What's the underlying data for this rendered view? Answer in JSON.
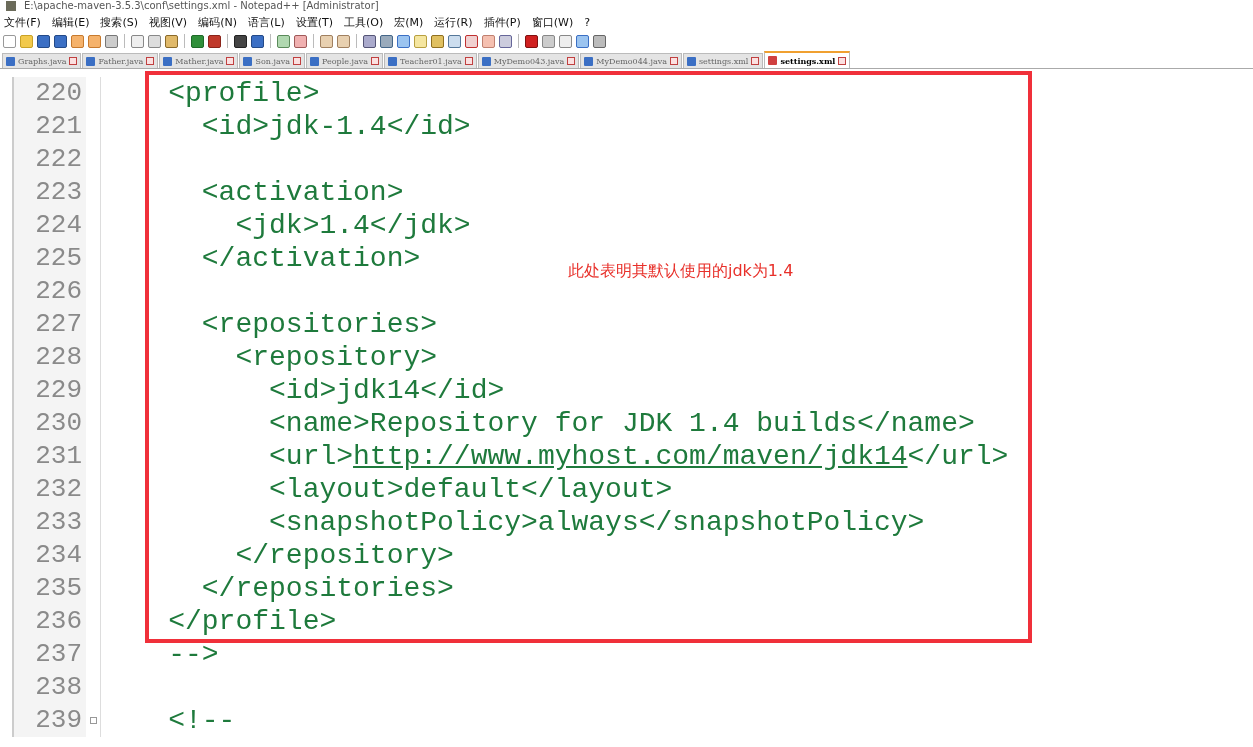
{
  "window": {
    "title": "E:\\apache-maven-3.5.3\\conf\\settings.xml - Notepad++ [Administrator]"
  },
  "menu": [
    "文件(F)",
    "编辑(E)",
    "搜索(S)",
    "视图(V)",
    "编码(N)",
    "语言(L)",
    "设置(T)",
    "工具(O)",
    "宏(M)",
    "运行(R)",
    "插件(P)",
    "窗口(W)",
    "?"
  ],
  "tabs": [
    {
      "label": "Graphs.java",
      "selected": false
    },
    {
      "label": "Father.java",
      "selected": false
    },
    {
      "label": "Mather.java",
      "selected": false
    },
    {
      "label": "Son.java",
      "selected": false
    },
    {
      "label": "People.java",
      "selected": false
    },
    {
      "label": "Teacher01.java",
      "selected": false
    },
    {
      "label": "MyDemo043.java",
      "selected": false
    },
    {
      "label": "MyDemo044.java",
      "selected": false
    },
    {
      "label": "settings.xml",
      "selected": false
    },
    {
      "label": "settings.xml",
      "selected": true
    }
  ],
  "editor": {
    "lines": [
      {
        "number": "220",
        "parts": [
          {
            "kind": "code",
            "text": "    <profile>"
          }
        ]
      },
      {
        "number": "221",
        "parts": [
          {
            "kind": "code",
            "text": "      <id>jdk-1.4</id>"
          }
        ]
      },
      {
        "number": "222"
      },
      {
        "number": "223",
        "parts": [
          {
            "kind": "code",
            "text": "      <activation>"
          }
        ]
      },
      {
        "number": "224",
        "parts": [
          {
            "kind": "code",
            "text": "        <jdk>1.4</jdk>"
          }
        ]
      },
      {
        "number": "225",
        "parts": [
          {
            "kind": "code",
            "text": "      </activation>"
          }
        ]
      },
      {
        "number": "226"
      },
      {
        "number": "227",
        "parts": [
          {
            "kind": "code",
            "text": "      <repositories>"
          }
        ]
      },
      {
        "number": "228",
        "parts": [
          {
            "kind": "code",
            "text": "        <repository>"
          }
        ]
      },
      {
        "number": "229",
        "parts": [
          {
            "kind": "code",
            "text": "          <id>jdk14</id>"
          }
        ]
      },
      {
        "number": "230",
        "parts": [
          {
            "kind": "code",
            "text": "          <name>Repository for JDK 1.4 builds</name>"
          }
        ]
      },
      {
        "number": "231",
        "parts": [
          {
            "kind": "code",
            "text": "          <url>"
          },
          {
            "kind": "link",
            "text": "http://www.myhost.com/maven/jdk14"
          },
          {
            "kind": "code",
            "text": "</url>"
          }
        ]
      },
      {
        "number": "232",
        "parts": [
          {
            "kind": "code",
            "text": "          <layout>default</layout>"
          }
        ]
      },
      {
        "number": "233",
        "parts": [
          {
            "kind": "code",
            "text": "          <snapshotPolicy>always</snapshotPolicy>"
          }
        ]
      },
      {
        "number": "234",
        "parts": [
          {
            "kind": "code",
            "text": "        </repository>"
          }
        ]
      },
      {
        "number": "235",
        "parts": [
          {
            "kind": "code",
            "text": "      </repositories>"
          }
        ]
      },
      {
        "number": "236",
        "parts": [
          {
            "kind": "code",
            "text": "    </profile>"
          }
        ]
      },
      {
        "number": "237",
        "parts": [
          {
            "kind": "code",
            "text": "    -->"
          }
        ]
      },
      {
        "number": "238"
      },
      {
        "number": "239",
        "parts": [
          {
            "kind": "code",
            "text": "    <!--"
          }
        ]
      }
    ]
  },
  "annotation": {
    "text": "此处表明其默认使用的jdk为1.4"
  }
}
